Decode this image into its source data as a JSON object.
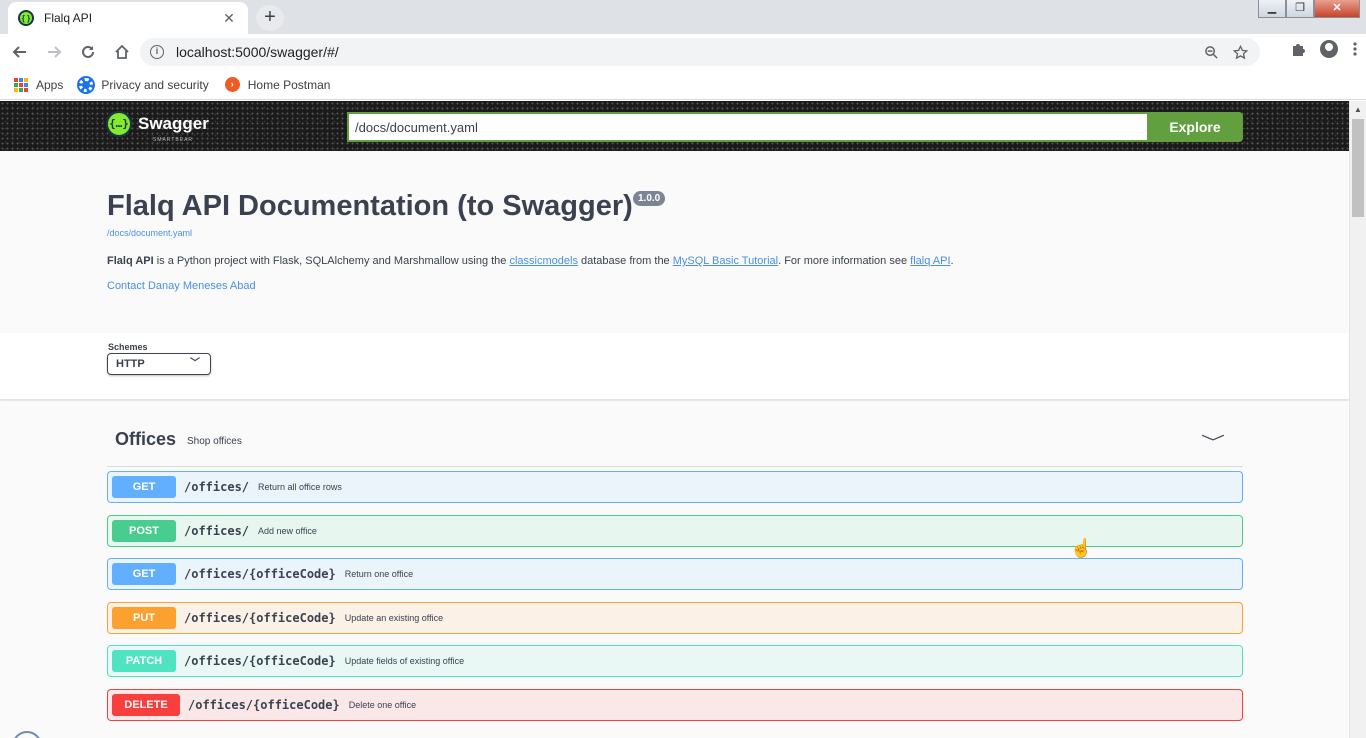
{
  "browser": {
    "tab_title": "Flalq API",
    "tab_close": "✕",
    "new_tab": "+",
    "url": "localhost:5000/swagger/#/",
    "window_buttons": [
      "▁",
      "❐",
      "✕"
    ],
    "bookmarks": [
      {
        "label": "Apps",
        "icon": "apps-grid-icon"
      },
      {
        "label": "Privacy and security",
        "icon": "gear-icon"
      },
      {
        "label": "Home Postman",
        "icon": "postman-icon"
      }
    ]
  },
  "swagger": {
    "logo_text": "Swagger",
    "logo_sub": "SMARTBEAR",
    "explore_value": "/docs/document.yaml",
    "explore_label": "Explore"
  },
  "info": {
    "title": "Flalq API Documentation (to Swagger)",
    "version": "1.0.0",
    "doc_url": "/docs/document.yaml",
    "desc_bold": "Flalq API",
    "desc_part1": " is a Python project with Flask, SQLAlchemy and Marshmallow using the ",
    "desc_link1": "classicmodels",
    "desc_part2": " database from the ",
    "desc_link2": "MySQL Basic Tutorial",
    "desc_part3": ". For more information see ",
    "desc_link3": "flalq API",
    "desc_part4": ".",
    "contact": "Contact Danay Meneses Abad"
  },
  "schemes": {
    "label": "Schemes",
    "selected": "HTTP"
  },
  "tag": {
    "name": "Offices",
    "description": "Shop offices"
  },
  "operations": [
    {
      "method": "GET",
      "path": "/offices/",
      "summary": "Return all office rows",
      "color": "#61affe",
      "bg": "#ebf3fb",
      "border": "#61affe"
    },
    {
      "method": "POST",
      "path": "/offices/",
      "summary": "Add new office",
      "color": "#49cc90",
      "bg": "#e8f6f0",
      "border": "#49cc90"
    },
    {
      "method": "GET",
      "path": "/offices/{officeCode}",
      "summary": "Return one office",
      "color": "#61affe",
      "bg": "#ebf3fb",
      "border": "#61affe"
    },
    {
      "method": "PUT",
      "path": "/offices/{officeCode}",
      "summary": "Update an existing office",
      "color": "#fca130",
      "bg": "#fbf1e6",
      "border": "#fca130"
    },
    {
      "method": "PATCH",
      "path": "/offices/{officeCode}",
      "summary": "Update fields of existing office",
      "color": "#50e3c2",
      "bg": "#e9f8f5",
      "border": "#50e3c2"
    },
    {
      "method": "DELETE",
      "path": "/offices/{officeCode}",
      "summary": "Delete one office",
      "color": "#f93e3e",
      "bg": "#fae7e7",
      "border": "#f93e3e"
    }
  ]
}
